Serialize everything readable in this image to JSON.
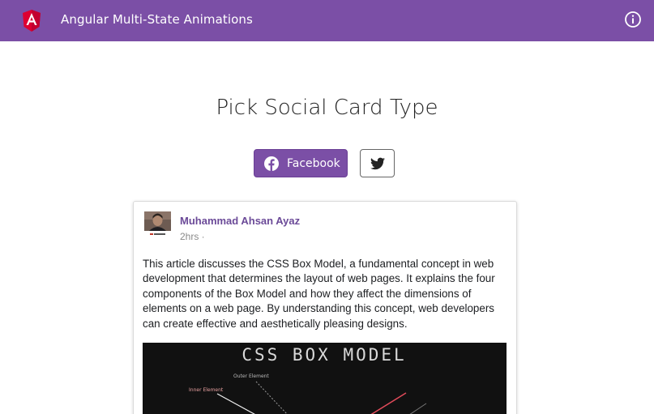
{
  "header": {
    "title": "Angular Multi-State Animations",
    "logo_icon": "angular-logo-icon",
    "info_icon": "info-icon",
    "background": "#7b4fa6"
  },
  "main": {
    "title": "Pick Social Card Type",
    "buttons": {
      "facebook_label": "Facebook",
      "facebook_icon": "facebook-icon",
      "twitter_icon": "twitter-icon",
      "active": "facebook"
    }
  },
  "card": {
    "author": "Muhammad Ahsan Ayaz",
    "timestamp": "2hrs ·",
    "text": "This article discusses the CSS Box Model, a fundamental concept in web development that determines the layout of web pages. It explains the four components of the Box Model and how they affect the dimensions of elements on a web page. By understanding this concept, web developers can create effective and aesthetically pleasing designs.",
    "image": {
      "heading": "CSS BOX MODEL",
      "labels": {
        "outer": "Outer Element",
        "inner": "Inner Element"
      }
    }
  }
}
